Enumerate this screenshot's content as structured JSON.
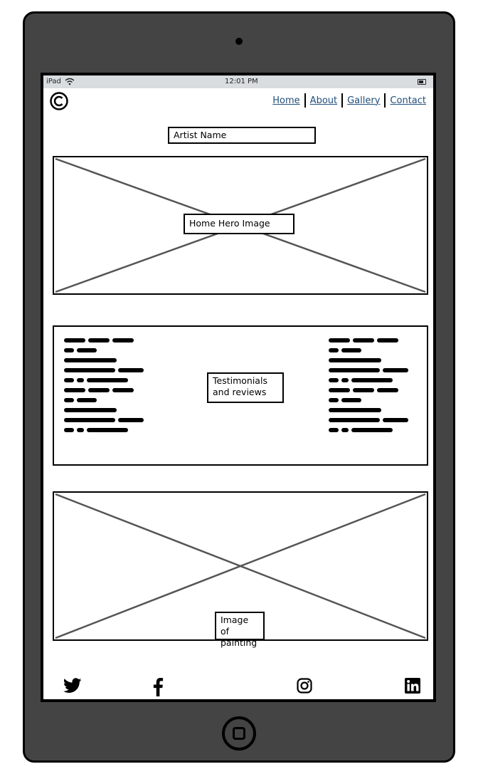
{
  "status_bar": {
    "device": "iPad",
    "time": "12:01 PM"
  },
  "nav": {
    "items": [
      {
        "label": "Home"
      },
      {
        "label": "About"
      },
      {
        "label": "Gallery"
      },
      {
        "label": "Contact"
      }
    ]
  },
  "header": {
    "logo_icon": "copyright-icon",
    "artist_name": "Artist Name"
  },
  "hero": {
    "label": "Home Hero Image"
  },
  "testimonials": {
    "label_line1": "Testimonials",
    "label_line2": "and reviews"
  },
  "painting": {
    "label_line1": "Image of",
    "label_line2": "painting"
  },
  "footer": {
    "social_icons": [
      "twitter-icon",
      "facebook-icon",
      "instagram-icon",
      "linkedin-icon"
    ]
  }
}
